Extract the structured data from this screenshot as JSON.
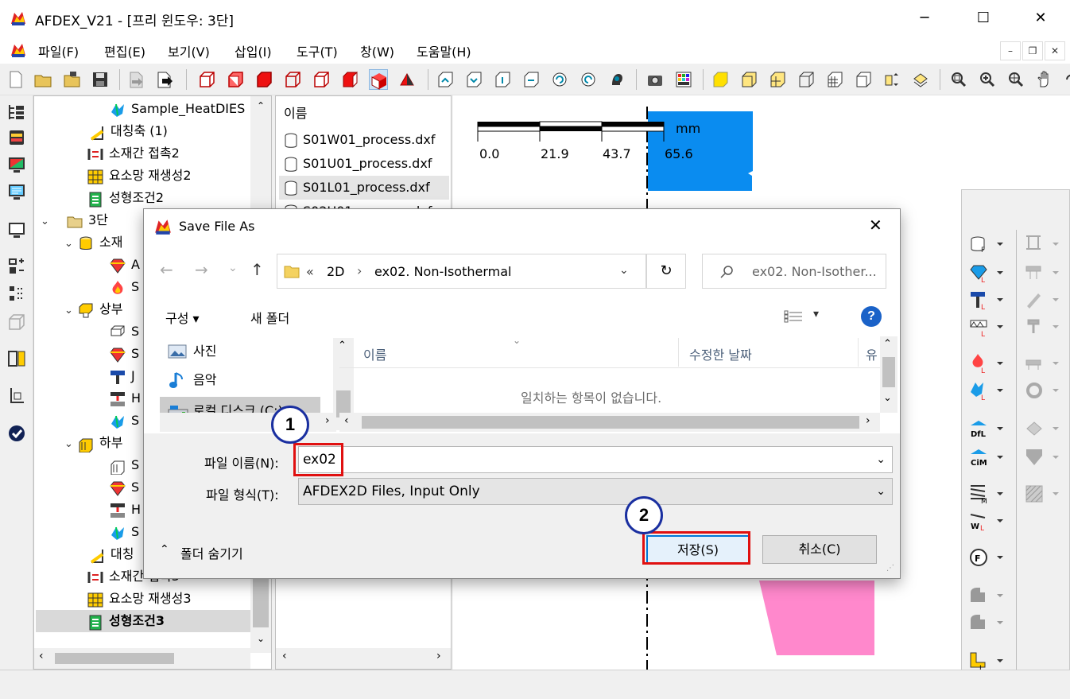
{
  "window": {
    "title": "AFDEX_V21 - [프리 윈도우: 3단]",
    "minimize": "─",
    "maximize": "☐",
    "close": "✕"
  },
  "menu": [
    "파일(F)",
    "편집(E)",
    "보기(V)",
    "삽입(I)",
    "도구(T)",
    "창(W)",
    "도움말(H)"
  ],
  "mdi": {
    "minimize": "–",
    "restore": "❐",
    "close": "✕"
  },
  "tree": [
    {
      "label": "Sample_HeatDIES",
      "icon": "crystal-icon"
    },
    {
      "label": "대칭축 (1)",
      "icon": "symmetry-axis-icon"
    },
    {
      "label": "소재간 접촉2",
      "icon": "contact-icon"
    },
    {
      "label": "요소망 재생성2",
      "icon": "remesh-icon"
    },
    {
      "label": "성형조건2",
      "icon": "condition-icon"
    },
    {
      "label": "3단",
      "icon": "folder-icon"
    },
    {
      "label": "소재",
      "icon": "material-icon"
    },
    {
      "label": "A",
      "icon": "crystal-icon"
    },
    {
      "label": "S",
      "icon": "heat-icon"
    },
    {
      "label": "상부",
      "icon": "upper-die-icon"
    },
    {
      "label": "S",
      "icon": "die-icon"
    },
    {
      "label": "S",
      "icon": "crystal-icon"
    },
    {
      "label": "J",
      "icon": "hammer-icon"
    },
    {
      "label": "H",
      "icon": "press-icon"
    },
    {
      "label": "S",
      "icon": "crystal-icon"
    },
    {
      "label": "하부",
      "icon": "lower-die-icon"
    },
    {
      "label": "S",
      "icon": "die-icon"
    },
    {
      "label": "S",
      "icon": "crystal-icon"
    },
    {
      "label": "H",
      "icon": "press-icon"
    },
    {
      "label": "S",
      "icon": "crystal-icon"
    },
    {
      "label": "대칭",
      "icon": "symmetry-axis-icon"
    },
    {
      "label": "소재간 접촉3",
      "icon": "contact-icon"
    },
    {
      "label": "요소망 재생성3",
      "icon": "remesh-icon"
    },
    {
      "label": "성형조건3",
      "icon": "condition-icon"
    }
  ],
  "filelist": {
    "header": "이름",
    "files": [
      "S01W01_process.dxf",
      "S01U01_process.dxf",
      "S01L01_process.dxf",
      "S02U01_process.dxf"
    ]
  },
  "canvas": {
    "scale_unit": "mm",
    "scale_ticks": [
      "0.0",
      "21.9",
      "43.7",
      "65.6"
    ],
    "colors": {
      "upper": "#0a8cf0",
      "lower": "#ff88cc"
    }
  },
  "dialog": {
    "title": "Save File As",
    "nav": {
      "back": "←",
      "forward": "→",
      "recent": "⌄",
      "up": "↑"
    },
    "breadcrumb": [
      "«",
      "2D",
      "›",
      "ex02. Non-Isothermal"
    ],
    "refresh": "↻",
    "search_placeholder": "ex02. Non-Isother...",
    "toolbar": {
      "organize": "구성 ▾",
      "new_folder": "새 폴더",
      "view": "▾",
      "help": "?"
    },
    "nav_items": [
      "사진",
      "음악",
      "로컬 디스크 (C:)"
    ],
    "columns": [
      "이름",
      "수정한 날짜",
      "유"
    ],
    "empty_message": "일치하는 항목이 없습니다.",
    "filename_label": "파일 이름(N):",
    "filename_value": "ex02",
    "filetype_label": "파일 형식(T):",
    "filetype_value": "AFDEX2D Files, Input Only",
    "hide_folders": "폴더 숨기기",
    "save": "저장(S)",
    "cancel": "취소(C)",
    "close": "✕"
  },
  "callouts": [
    "1",
    "2"
  ]
}
